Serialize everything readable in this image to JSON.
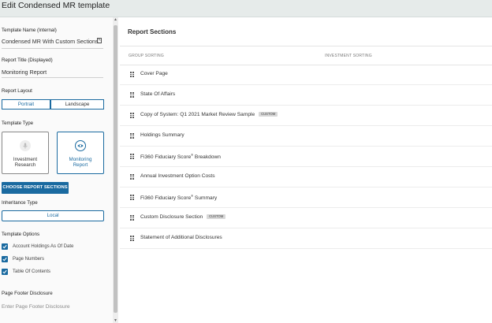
{
  "window": {
    "title": "Edit Condensed MR template"
  },
  "left_panel": {
    "template_name": {
      "label": "Template Name (Internal)",
      "value": "Condensed MR With Custom Sections"
    },
    "report_title": {
      "label": "Report Title (Displayed)",
      "value": "Monitoring Report"
    },
    "report_layout": {
      "label": "Report Layout",
      "options": [
        "Portrait",
        "Landscape"
      ],
      "selected": "Portrait"
    },
    "template_type": {
      "label": "Template Type",
      "options": [
        {
          "label_line1": "Investment",
          "label_line2": "Research",
          "icon": "microphone-icon",
          "selected": false
        },
        {
          "label_line1": "Monitoring",
          "label_line2": "Report",
          "icon": "eye-icon",
          "selected": true
        }
      ]
    },
    "choose_button": "CHOOSE REPORT SECTIONS",
    "inheritance": {
      "label": "Inheritance Type",
      "value": "Local"
    },
    "template_options": {
      "label": "Template Options",
      "items": [
        {
          "label": "Account Holdings As Of Date",
          "checked": true
        },
        {
          "label": "Page Numbers",
          "checked": true
        },
        {
          "label": "Table Of Contents",
          "checked": true
        }
      ]
    },
    "footer_disclosure": {
      "label": "Page Footer Disclosure",
      "placeholder": "Enter Page Footer Disclosure"
    }
  },
  "right_panel": {
    "title": "Report Sections",
    "columns": [
      "GROUP SORTING",
      "INVESTMENT SORTING"
    ],
    "sections": [
      {
        "label": "Cover Page"
      },
      {
        "label": "State Of Affairs"
      },
      {
        "label": "Copy of System: Q1 2021 Market Review Sample",
        "badge": "CUSTOM"
      },
      {
        "label": "Holdings Summary"
      },
      {
        "label_before": "Fi360 Fiduciary Score",
        "sup": "®",
        "label_after": " Breakdown"
      },
      {
        "label": "Annual Investment Option Costs"
      },
      {
        "label_before": "Fi360 Fiduciary Score",
        "sup": "®",
        "label_after": " Summary"
      },
      {
        "label": "Custom Disclosure Section",
        "badge": "CUSTOM"
      },
      {
        "label": "Statement of Additional Disclosures"
      }
    ]
  },
  "colors": {
    "accent": "#1a6aa0",
    "topbar_bg": "#e6ebea"
  }
}
